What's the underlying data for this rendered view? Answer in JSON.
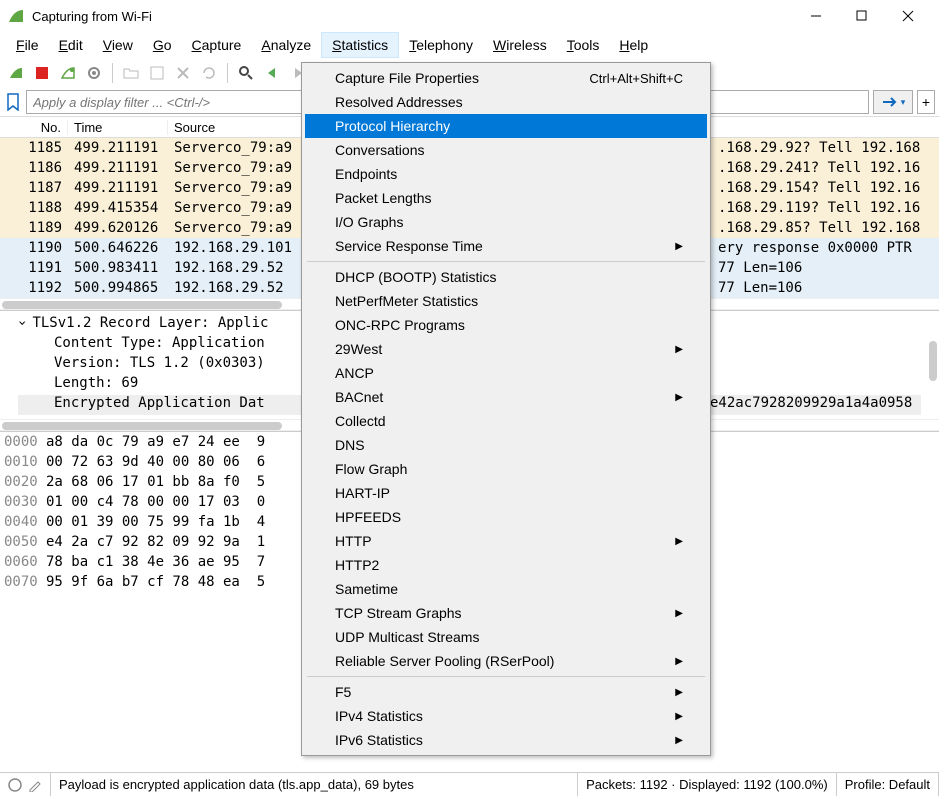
{
  "window": {
    "title": "Capturing from Wi-Fi"
  },
  "menubar": [
    "File",
    "Edit",
    "View",
    "Go",
    "Capture",
    "Analyze",
    "Statistics",
    "Telephony",
    "Wireless",
    "Tools",
    "Help"
  ],
  "open_menu": "Statistics",
  "filter": {
    "placeholder": "Apply a display filter ... <Ctrl-/>"
  },
  "columns": {
    "no": "No.",
    "time": "Time",
    "source": "Source"
  },
  "packets": [
    {
      "no": "1185",
      "time": "499.211191",
      "src": "Serverco_79:a9",
      "rest": ".168.29.92? Tell 192.168",
      "cls": "row-yellow"
    },
    {
      "no": "1186",
      "time": "499.211191",
      "src": "Serverco_79:a9",
      "rest": ".168.29.241? Tell 192.16",
      "cls": "row-yellow"
    },
    {
      "no": "1187",
      "time": "499.211191",
      "src": "Serverco_79:a9",
      "rest": ".168.29.154? Tell 192.16",
      "cls": "row-yellow"
    },
    {
      "no": "1188",
      "time": "499.415354",
      "src": "Serverco_79:a9",
      "rest": ".168.29.119? Tell 192.16",
      "cls": "row-yellow"
    },
    {
      "no": "1189",
      "time": "499.620126",
      "src": "Serverco_79:a9",
      "rest": ".168.29.85? Tell 192.168",
      "cls": "row-yellow"
    },
    {
      "no": "1190",
      "time": "500.646226",
      "src": "192.168.29.101",
      "rest": "ery response 0x0000 PTR",
      "cls": "row-blue"
    },
    {
      "no": "1191",
      "time": "500.983411",
      "src": "192.168.29.52",
      "rest": "77 Len=106",
      "cls": "row-blue"
    },
    {
      "no": "1192",
      "time": "500.994865",
      "src": "192.168.29.52",
      "rest": "77 Len=106",
      "cls": "row-blue"
    }
  ],
  "details": [
    {
      "caret": true,
      "indent": 0,
      "text": "TLSv1.2 Record Layer: Applic",
      "hl": false
    },
    {
      "caret": false,
      "indent": 1,
      "text": "Content Type: Application",
      "hl": false
    },
    {
      "caret": false,
      "indent": 1,
      "text": "Version: TLS 1.2 (0x0303)",
      "hl": false
    },
    {
      "caret": false,
      "indent": 1,
      "text": "Length: 69",
      "hl": false
    },
    {
      "caret": false,
      "indent": 1,
      "text": "Encrypted Application Dat",
      "hl": true,
      "tail": "e42ac7928209929a1a4a0958"
    }
  ],
  "hex": [
    {
      "off": "0000",
      "bytes": "a8 da 0c 79 a9 e7 24 ee  9"
    },
    {
      "off": "0010",
      "bytes": "00 72 63 9d 40 00 80 06  6"
    },
    {
      "off": "0020",
      "bytes": "2a 68 06 17 01 bb 8a f0  5"
    },
    {
      "off": "0030",
      "bytes": "01 00 c4 78 00 00 17 03  0"
    },
    {
      "off": "0040",
      "bytes": "00 01 39 00 75 99 fa 1b  4"
    },
    {
      "off": "0050",
      "bytes": "e4 2a c7 92 82 09 92 9a  1"
    },
    {
      "off": "0060",
      "bytes": "78 ba c1 38 4e 36 ae 95  7"
    },
    {
      "off": "0070",
      "bytes": "95 9f 6a b7 cf 78 48 ea  5"
    }
  ],
  "dropdown": [
    {
      "label": "Capture File Properties",
      "shortcut": "Ctrl+Alt+Shift+C"
    },
    {
      "label": "Resolved Addresses"
    },
    {
      "label": "Protocol Hierarchy",
      "selected": true
    },
    {
      "label": "Conversations"
    },
    {
      "label": "Endpoints"
    },
    {
      "label": "Packet Lengths"
    },
    {
      "label": "I/O Graphs"
    },
    {
      "label": "Service Response Time",
      "sub": true
    },
    {
      "sep": true
    },
    {
      "label": "DHCP (BOOTP) Statistics"
    },
    {
      "label": "NetPerfMeter Statistics"
    },
    {
      "label": "ONC-RPC Programs"
    },
    {
      "label": "29West",
      "sub": true
    },
    {
      "label": "ANCP"
    },
    {
      "label": "BACnet",
      "sub": true
    },
    {
      "label": "Collectd"
    },
    {
      "label": "DNS"
    },
    {
      "label": "Flow Graph"
    },
    {
      "label": "HART-IP"
    },
    {
      "label": "HPFEEDS"
    },
    {
      "label": "HTTP",
      "sub": true
    },
    {
      "label": "HTTP2"
    },
    {
      "label": "Sametime"
    },
    {
      "label": "TCP Stream Graphs",
      "sub": true
    },
    {
      "label": "UDP Multicast Streams"
    },
    {
      "label": "Reliable Server Pooling (RSerPool)",
      "sub": true
    },
    {
      "sep": true
    },
    {
      "label": "F5",
      "sub": true
    },
    {
      "label": "IPv4 Statistics",
      "sub": true
    },
    {
      "label": "IPv6 Statistics",
      "sub": true
    }
  ],
  "status": {
    "main": "Payload is encrypted application data (tls.app_data), 69 bytes",
    "packets": "Packets: 1192 · Displayed: 1192 (100.0%)",
    "profile": "Profile: Default"
  }
}
